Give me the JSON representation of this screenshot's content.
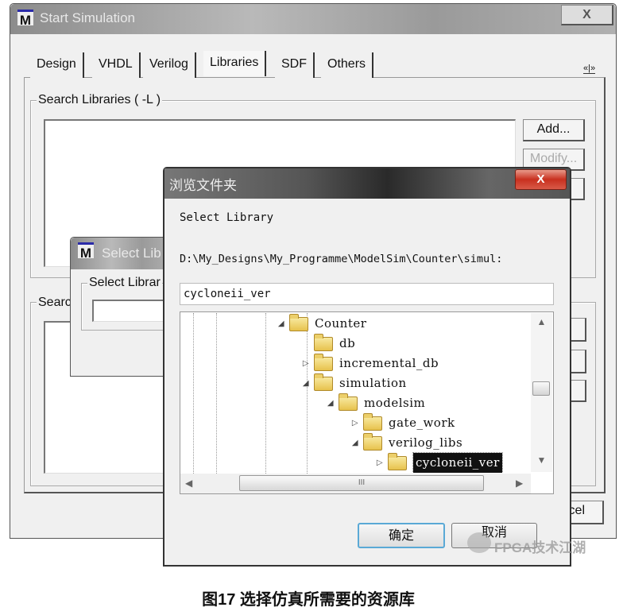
{
  "main_window": {
    "title": "Start Simulation",
    "close_label": "X",
    "tabs": [
      {
        "label": "Design"
      },
      {
        "label": "VHDL"
      },
      {
        "label": "Verilog"
      },
      {
        "label": "Libraries",
        "selected": true
      },
      {
        "label": "SDF"
      },
      {
        "label": "Others"
      }
    ],
    "tab_scroll_label": "«|»",
    "search_libraries": {
      "label": "Search Libraries ( -L )",
      "add_label": "Add...",
      "modify_label": "Modify..."
    },
    "search_second": {
      "label": "Searc"
    },
    "cancel_partial": "cel"
  },
  "select_library_dialog": {
    "title": "Select Lib",
    "group_label": "Select Librar"
  },
  "browse_dialog": {
    "title": "浏览文件夹",
    "close_label": "X",
    "prompt": "Select Library",
    "path": "D:\\My_Designs\\My_Programme\\ModelSim\\Counter\\simul:",
    "folder_input": "cycloneii_ver",
    "tree": [
      {
        "label": "Counter",
        "level": 0,
        "state": "expanded"
      },
      {
        "label": "db",
        "level": 1,
        "state": "leaf"
      },
      {
        "label": "incremental_db",
        "level": 1,
        "state": "collapsed"
      },
      {
        "label": "simulation",
        "level": 1,
        "state": "expanded"
      },
      {
        "label": "modelsim",
        "level": 2,
        "state": "expanded"
      },
      {
        "label": "gate_work",
        "level": 3,
        "state": "collapsed"
      },
      {
        "label": "verilog_libs",
        "level": 3,
        "state": "expanded"
      },
      {
        "label": "cycloneii_ver",
        "level": 4,
        "state": "collapsed",
        "selected": true
      }
    ],
    "hscroll_grip": "III",
    "ok_label": "确定",
    "cancel_label": "取消"
  },
  "watermark": "FPGA技术江湖",
  "caption": "图17 选择仿真所需要的资源库"
}
